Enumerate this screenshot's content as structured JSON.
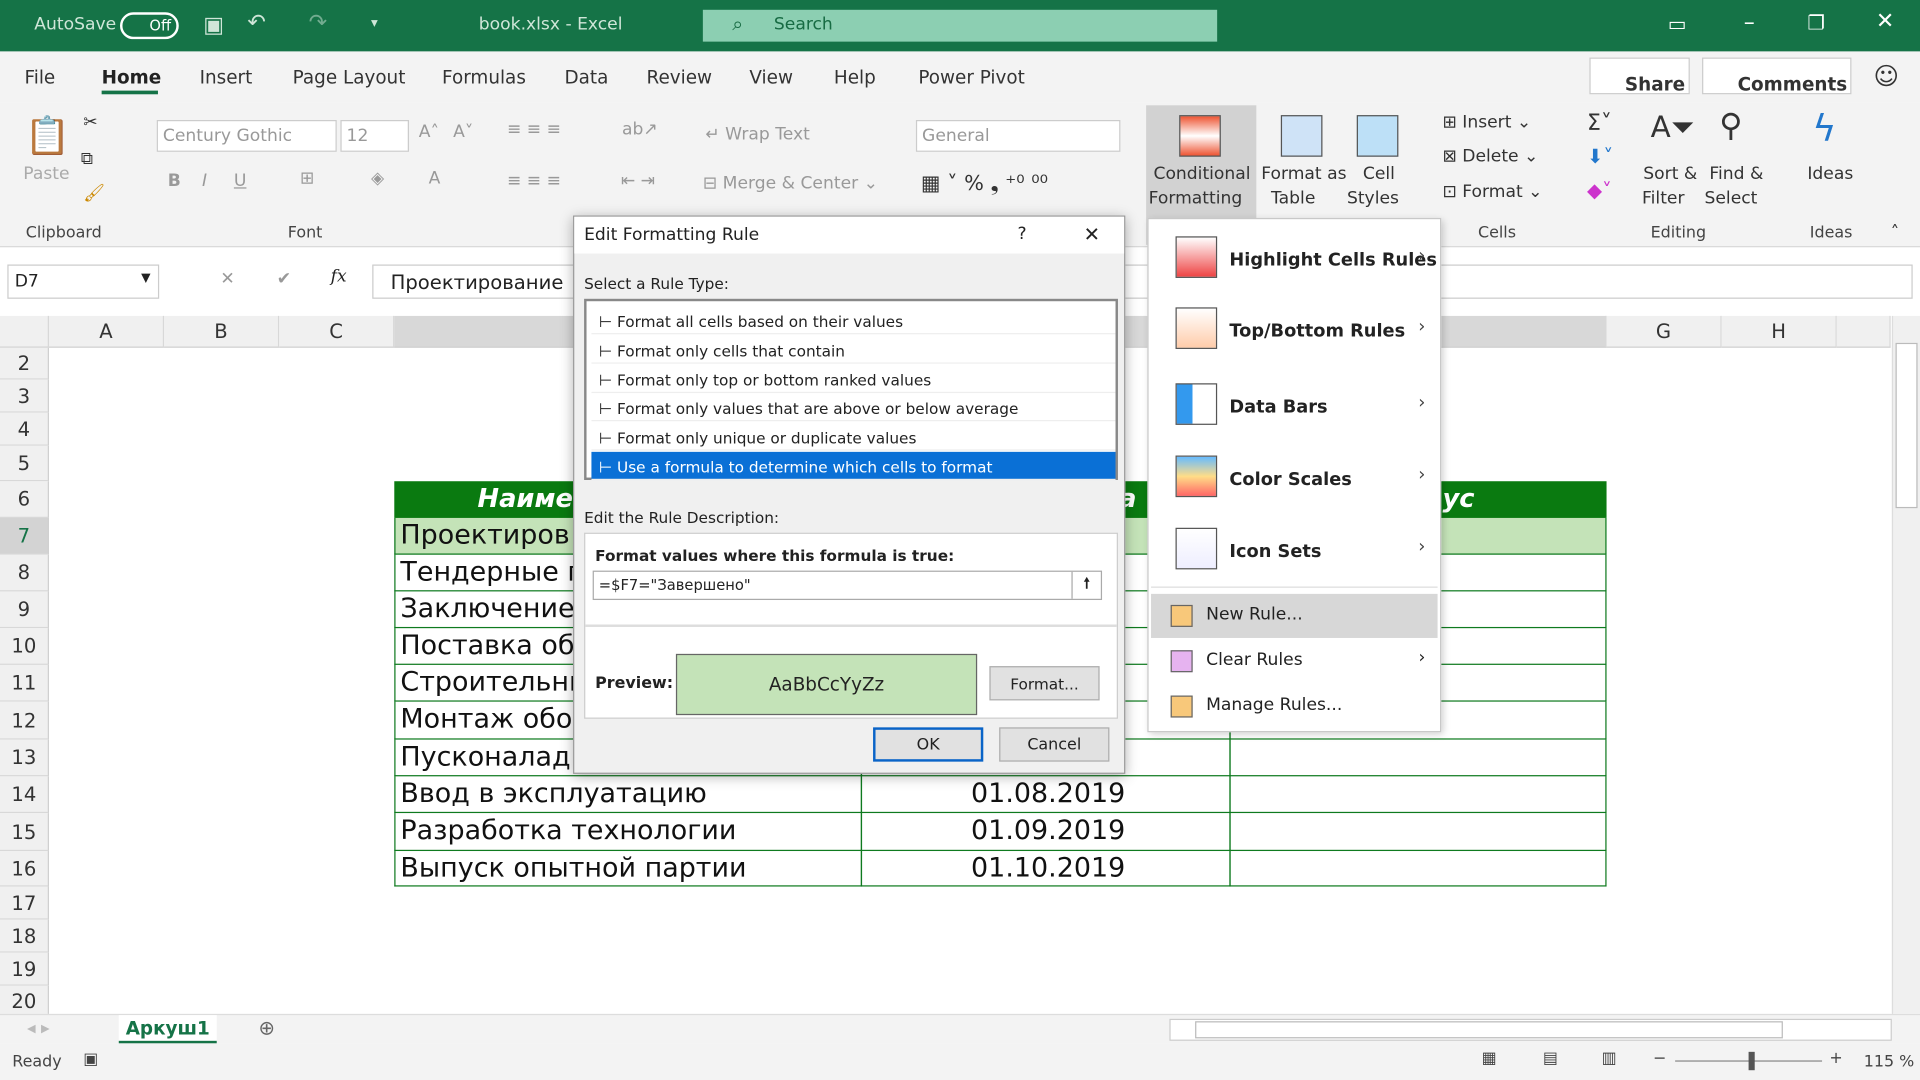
{
  "titlebar": {
    "autosave": "AutoSave",
    "toggle": "Off",
    "title": "book.xlsx  -  Excel",
    "search": "Search"
  },
  "tabs": [
    "File",
    "Home",
    "Insert",
    "Page Layout",
    "Formulas",
    "Data",
    "Review",
    "View",
    "Help",
    "Power Pivot"
  ],
  "share": "Share",
  "comments": "Comments",
  "ribbon": {
    "paste": "Paste",
    "clipboard": "Clipboard",
    "font_name": "Century Gothic",
    "font_size": "12",
    "font": "Font",
    "wrap": "Wrap Text",
    "merge": "Merge & Center",
    "number_format": "General",
    "cond1": "Conditional",
    "cond2": "Formatting",
    "fmt1": "Format as",
    "fmt2": "Table",
    "cs1": "Cell",
    "cs2": "Styles",
    "insert": "Insert",
    "delete": "Delete",
    "format": "Format",
    "cells": "Cells",
    "sort1": "Sort &",
    "sort2": "Filter",
    "find1": "Find &",
    "find2": "Select",
    "editing": "Editing",
    "ideas": "Ideas",
    "ideas_group": "Ideas"
  },
  "formula_bar": {
    "name_box": "D7",
    "fx": "fx",
    "value": "Проектирование"
  },
  "columns": [
    "A",
    "B",
    "C",
    "G",
    "H"
  ],
  "rows": [
    "2",
    "3",
    "4",
    "5",
    "6",
    "7",
    "8",
    "9",
    "10",
    "11",
    "12",
    "13",
    "14",
    "15",
    "16",
    "17",
    "18",
    "19",
    "20"
  ],
  "table": {
    "header": [
      "Наиме",
      "да",
      "ус"
    ],
    "rows": [
      [
        "Проектиров",
        ""
      ],
      [
        "Тендерные г",
        ""
      ],
      [
        "Заключение",
        ""
      ],
      [
        "Поставка об",
        ""
      ],
      [
        "Строительны",
        ""
      ],
      [
        "Монтаж обо",
        ""
      ],
      [
        "Пусконалад",
        ""
      ],
      [
        "Ввод в эксплуатацию",
        "01.08.2019"
      ],
      [
        "Разработка технологии",
        "01.09.2019"
      ],
      [
        "Выпуск опытной партии",
        "01.10.2019"
      ]
    ],
    "colors": {
      "header": "#0a7a10",
      "highlight": "#c4e3b8"
    }
  },
  "dialog": {
    "title": "Edit Formatting Rule",
    "help": "?",
    "select_label": "Select a Rule Type:",
    "rule_types": [
      "Format all cells based on their values",
      "Format only cells that contain",
      "Format only top or bottom ranked values",
      "Format only values that are above or below average",
      "Format only unique or duplicate values",
      "Use a formula to determine which cells to format"
    ],
    "selected_index": 5,
    "desc_label": "Edit the Rule Description:",
    "formula_label": "Format values where this formula is true:",
    "formula": "=$F7=\"Завершено\"",
    "preview_label": "Preview:",
    "preview_text": "AaBbCcYyZz",
    "format_btn": "Format...",
    "ok": "OK",
    "cancel": "Cancel"
  },
  "menu": {
    "items": [
      "Highlight Cells Rules",
      "Top/Bottom Rules",
      "Data Bars",
      "Color Scales",
      "Icon Sets"
    ],
    "sub": [
      "New Rule...",
      "Clear Rules",
      "Manage Rules..."
    ]
  },
  "sheet_tab": "Аркуш1",
  "status": {
    "ready": "Ready",
    "zoom": "115 %"
  }
}
